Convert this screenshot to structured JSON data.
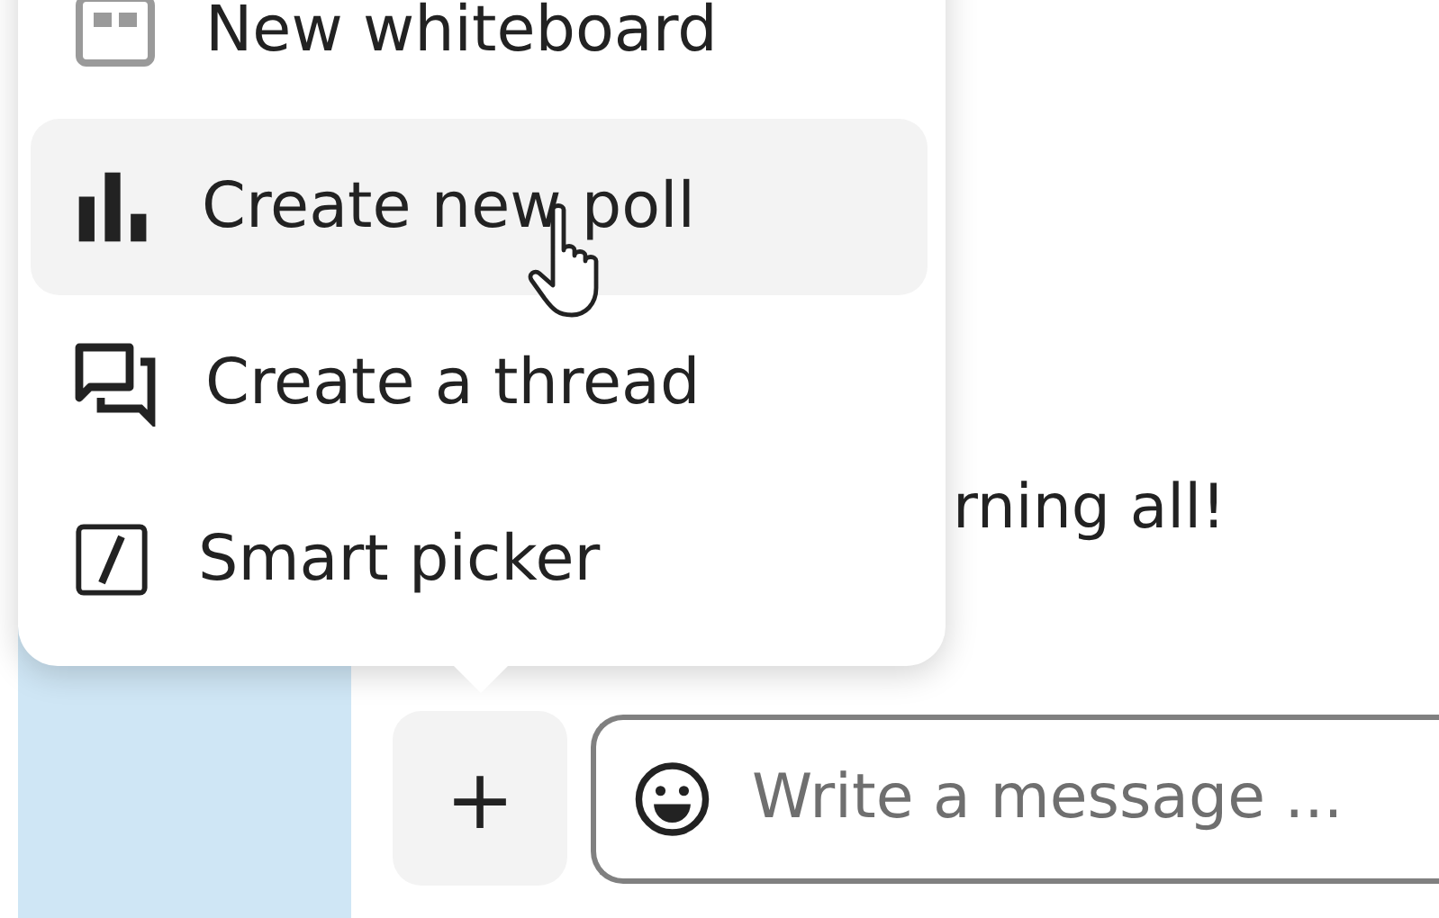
{
  "menu": {
    "items": [
      {
        "label": "New whiteboard",
        "kind": "whiteboard",
        "selected": false
      },
      {
        "label": "Create new poll",
        "kind": "poll",
        "selected": true
      },
      {
        "label": "Create a thread",
        "kind": "thread",
        "selected": false
      },
      {
        "label": "Smart picker",
        "kind": "picker",
        "selected": false
      }
    ]
  },
  "message": {
    "text": "rning all!"
  },
  "composer": {
    "add_button": "+",
    "placeholder": "Write a message ..."
  }
}
